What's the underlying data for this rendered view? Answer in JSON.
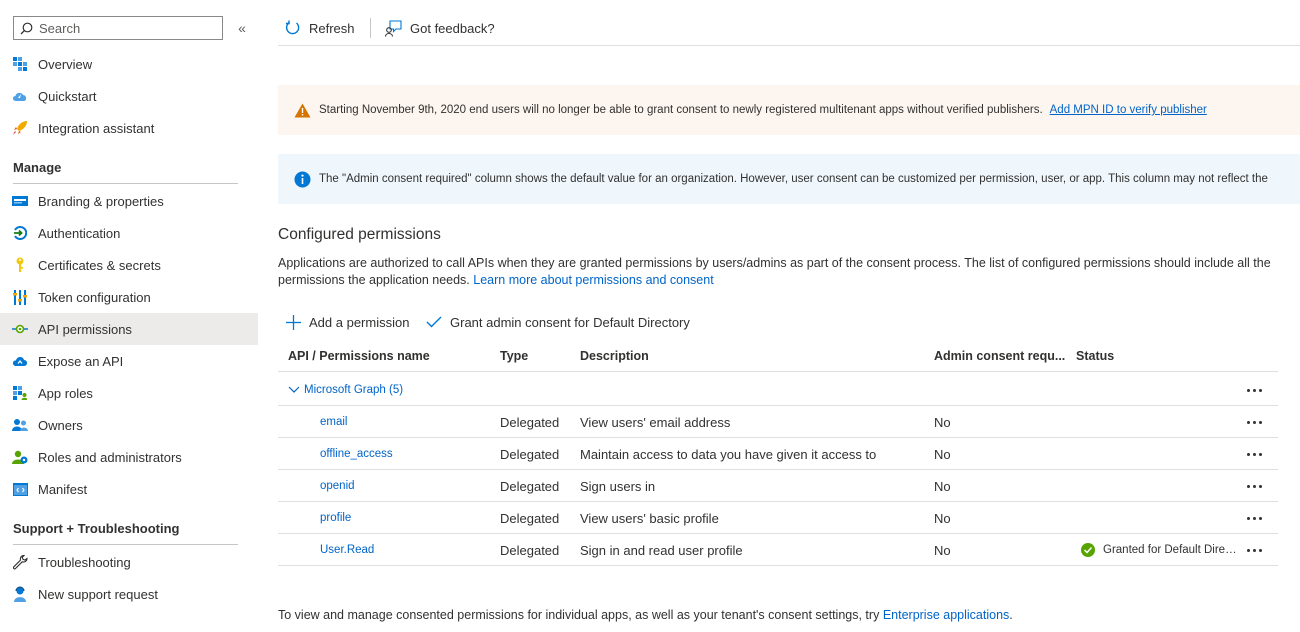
{
  "sidebar": {
    "search_placeholder": "Search",
    "collapse_glyph": "«",
    "items_top": [
      {
        "label": "Overview",
        "icon": "overview-icon"
      },
      {
        "label": "Quickstart",
        "icon": "quickstart-icon"
      },
      {
        "label": "Integration assistant",
        "icon": "rocket-icon"
      }
    ],
    "manage_heading": "Manage",
    "manage_items": [
      {
        "label": "Branding & properties",
        "icon": "branding-icon"
      },
      {
        "label": "Authentication",
        "icon": "authentication-icon"
      },
      {
        "label": "Certificates & secrets",
        "icon": "key-icon"
      },
      {
        "label": "Token configuration",
        "icon": "token-config-icon"
      },
      {
        "label": "API permissions",
        "icon": "api-permissions-icon",
        "selected": true
      },
      {
        "label": "Expose an API",
        "icon": "cloud-icon"
      },
      {
        "label": "App roles",
        "icon": "app-roles-icon"
      },
      {
        "label": "Owners",
        "icon": "owners-icon"
      },
      {
        "label": "Roles and administrators",
        "icon": "roles-icon"
      },
      {
        "label": "Manifest",
        "icon": "manifest-icon"
      }
    ],
    "support_heading": "Support + Troubleshooting",
    "support_items": [
      {
        "label": "Troubleshooting",
        "icon": "wrench-icon"
      },
      {
        "label": "New support request",
        "icon": "support-person-icon"
      }
    ]
  },
  "toolbar": {
    "refresh_label": "Refresh",
    "feedback_label": "Got feedback?"
  },
  "banners": {
    "warning_text": "Starting November 9th, 2020 end users will no longer be able to grant consent to newly registered multitenant apps without verified publishers.",
    "warning_link": "Add MPN ID to verify publisher",
    "info_text": "The \"Admin consent required\" column shows the default value for an organization. However, user consent can be customized per permission, user, or app. This column may not reflect the"
  },
  "permissions": {
    "heading": "Configured permissions",
    "description": "Applications are authorized to call APIs when they are granted permissions by users/admins as part of the consent process. The list of configured permissions should include all the permissions the application needs.",
    "learn_more": "Learn more about permissions and consent",
    "add_permission": "Add a permission",
    "grant_consent": "Grant admin consent for Default Directory",
    "columns": [
      "API / Permissions name",
      "Type",
      "Description",
      "Admin consent requ...",
      "Status"
    ],
    "group_label": "Microsoft Graph (5)",
    "rows": [
      {
        "name": "email",
        "type": "Delegated",
        "description": "View users' email address",
        "admin": "No",
        "status": ""
      },
      {
        "name": "offline_access",
        "type": "Delegated",
        "description": "Maintain access to data you have given it access to",
        "admin": "No",
        "status": ""
      },
      {
        "name": "openid",
        "type": "Delegated",
        "description": "Sign users in",
        "admin": "No",
        "status": ""
      },
      {
        "name": "profile",
        "type": "Delegated",
        "description": "View users' basic profile",
        "admin": "No",
        "status": ""
      },
      {
        "name": "User.Read",
        "type": "Delegated",
        "description": "Sign in and read user profile",
        "admin": "No",
        "status": "Granted for Default Directory"
      }
    ]
  },
  "footer": {
    "text": "To view and manage consented permissions for individual apps, as well as your tenant's consent settings, try",
    "link": "Enterprise applications",
    "period": "."
  },
  "colors": {
    "link": "#0064c8",
    "selected_bg": "#edebe9",
    "warning_bg": "#fdf6f0",
    "info_bg": "#eff6fc",
    "success": "#57a300",
    "warning_icon": "#d47500",
    "info_icon": "#0078d4"
  }
}
